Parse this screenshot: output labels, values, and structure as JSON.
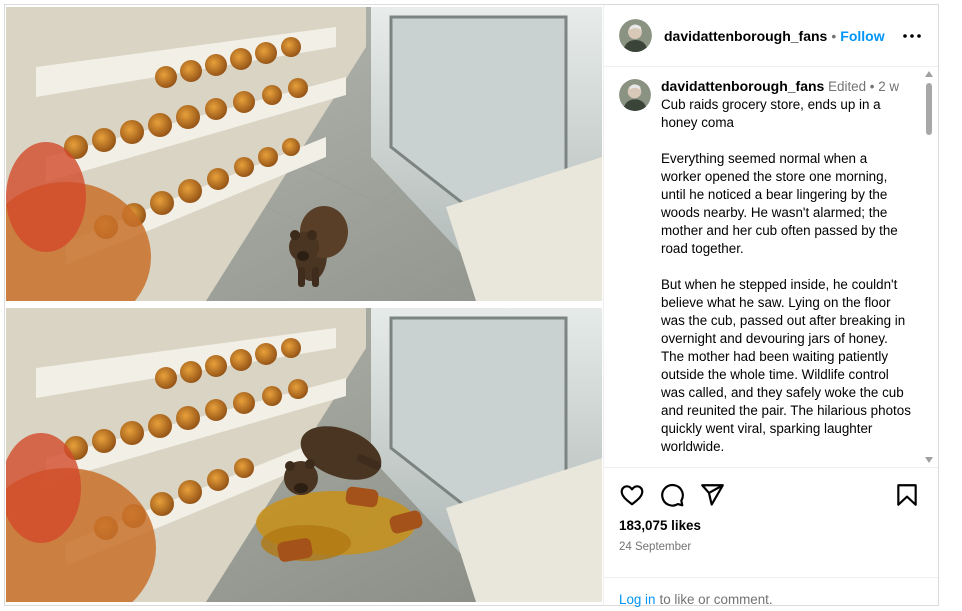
{
  "header": {
    "username": "davidattenborough_fans",
    "separator": "•",
    "follow_label": "Follow",
    "more_icon": "more-horizontal-icon"
  },
  "caption": {
    "username": "davidattenborough_fans",
    "edited_label": "Edited",
    "separator": "•",
    "time_ago": "2 w",
    "title": "Cub raids grocery store, ends up in a honey coma",
    "paragraphs": [
      "Everything seemed normal when a worker opened the store one morning, until he noticed a bear lingering by the woods nearby. He wasn't alarmed; the mother and her cub often passed by the road together.",
      "But when he stepped inside, he couldn't believe what he saw. Lying on the floor was the cub, passed out after breaking in overnight and devouring jars of honey. The mother had been waiting patiently outside the whole time. Wildlife control was called, and they safely woke the cub and reunited the pair. The hilarious photos quickly went viral, sparking laughter worldwide."
    ]
  },
  "actions": {
    "icons": [
      "heart-icon",
      "comment-icon",
      "share-icon",
      "bookmark-icon"
    ],
    "likes": "183,075 likes",
    "date": "24 September"
  },
  "footer": {
    "login_link": "Log in",
    "login_rest": "to like or comment."
  },
  "colors": {
    "link_blue": "#0095f6",
    "muted_gray": "#737373",
    "border": "#dbdbdb"
  }
}
